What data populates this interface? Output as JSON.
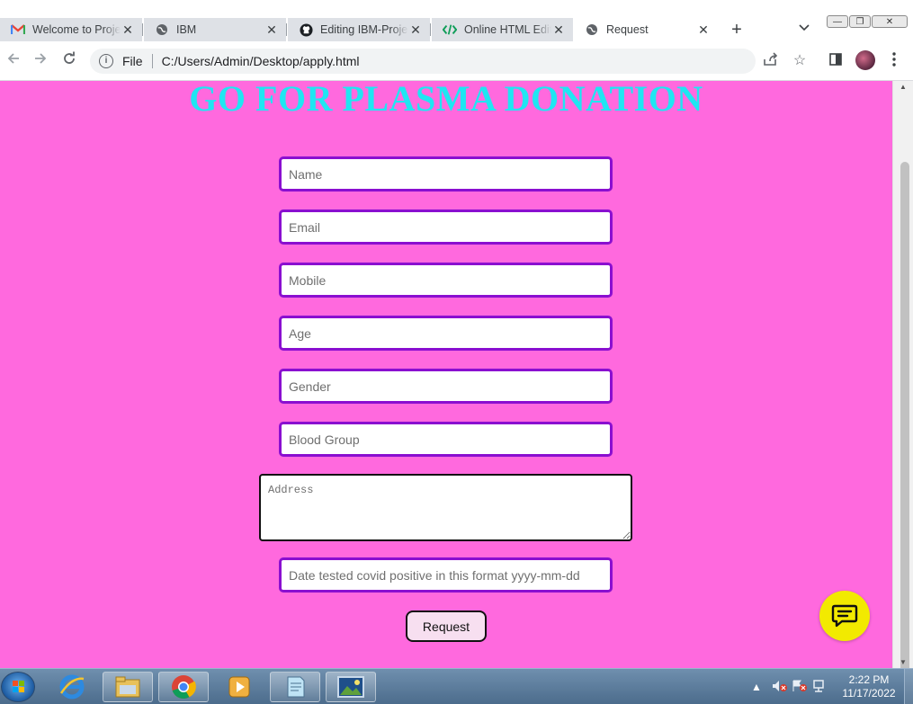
{
  "browser": {
    "tabs": [
      {
        "title": "Welcome to Proje",
        "icon": "gmail-icon",
        "active": false
      },
      {
        "title": "IBM",
        "icon": "globe-icon",
        "active": false
      },
      {
        "title": "Editing IBM-Proje",
        "icon": "github-icon",
        "active": false
      },
      {
        "title": "Online HTML Edit",
        "icon": "code-icon",
        "active": false
      },
      {
        "title": "Request",
        "icon": "globe-icon",
        "active": true
      }
    ],
    "address": {
      "scheme_label": "File",
      "url": "C:/Users/Admin/Desktop/apply.html"
    }
  },
  "page": {
    "heading": "GO FOR PLASMA DONATION",
    "fields": {
      "name": "Name",
      "email": "Email",
      "mobile": "Mobile",
      "age": "Age",
      "gender": "Gender",
      "blood_group": "Blood Group",
      "address": "Address",
      "covid_date": "Date tested covid positive in this format yyyy-mm-dd"
    },
    "submit_label": "Request",
    "colors": {
      "background": "#ff69de",
      "heading": "#1fe6f2",
      "field_border": "#8a0fd0",
      "chat_button": "#f2ea00"
    }
  },
  "taskbar": {
    "pinned": [
      "internet-explorer-icon",
      "file-explorer-icon",
      "chrome-icon",
      "media-player-icon",
      "notepad-icon",
      "image-viewer-icon"
    ],
    "time": "2:22 PM",
    "date": "11/17/2022"
  }
}
